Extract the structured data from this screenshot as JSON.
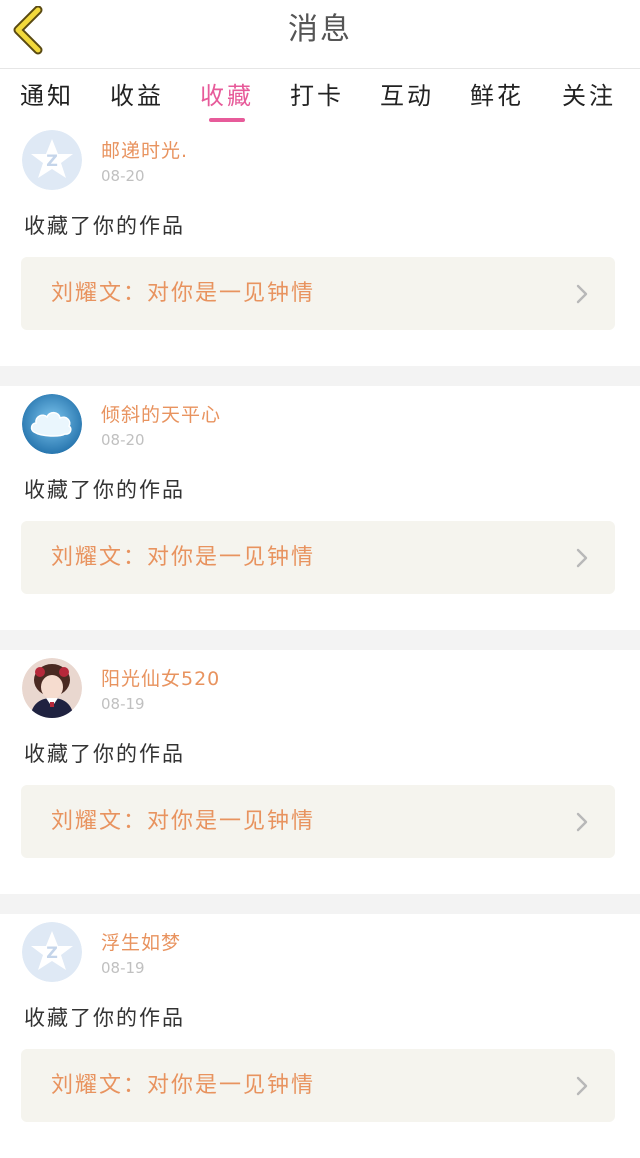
{
  "header": {
    "title": "消息",
    "back_icon": "chevron-left-icon"
  },
  "tabs": [
    {
      "label": "通知",
      "active": false
    },
    {
      "label": "收益",
      "active": false
    },
    {
      "label": "收藏",
      "active": true
    },
    {
      "label": "打卡",
      "active": false
    },
    {
      "label": "互动",
      "active": false
    },
    {
      "label": "鲜花",
      "active": false
    },
    {
      "label": "关注",
      "active": false
    }
  ],
  "colors": {
    "accent_pink": "#e75b9a",
    "name_orange": "#e8935f",
    "back_yellow": "#f2d93c"
  },
  "messages": [
    {
      "user": "邮递时光.",
      "date": "08-20",
      "action": "收藏了你的作品",
      "work": "刘耀文：对你是一见钟情",
      "avatar": "default-qq-avatar"
    },
    {
      "user": "倾斜的天平心",
      "date": "08-20",
      "action": "收藏了你的作品",
      "work": "刘耀文：对你是一见钟情",
      "avatar": "cloud-avatar"
    },
    {
      "user": "阳光仙女520",
      "date": "08-19",
      "action": "收藏了你的作品",
      "work": "刘耀文：对你是一见钟情",
      "avatar": "girl-photo-avatar"
    },
    {
      "user": "浮生如梦",
      "date": "08-19",
      "action": "收藏了你的作品",
      "work": "刘耀文：对你是一见钟情",
      "avatar": "default-qq-avatar"
    }
  ]
}
